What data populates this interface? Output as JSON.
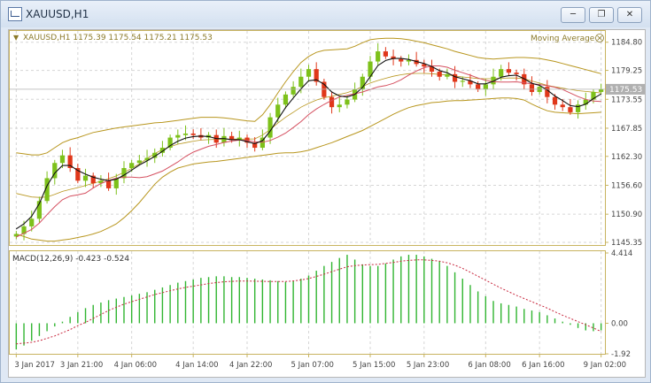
{
  "window": {
    "title": "XAUUSD,H1",
    "icon": "chart-window-icon",
    "buttons": [
      "minimize-icon",
      "restore-icon",
      "close-icon"
    ]
  },
  "header": {
    "symbol_info": "XAUUSD,H1  1175.39 1175.54 1175.21 1175.53",
    "indicator_label": "Moving Average"
  },
  "macd_label": "MACD(12,26,9) -0.423 -0.524",
  "price_badge": "1175.53",
  "colors": {
    "bull": "#7dc11a",
    "bear": "#e0371a",
    "band": "#b8961e",
    "ma_fast": "#111111",
    "ma_slow": "#d55060",
    "macd_hist": "#31b531",
    "macd_signal": "#c8283e",
    "grid": "#d6d6d6",
    "axis": "#c8b460"
  },
  "chart_data": [
    {
      "type": "candlestick",
      "title": "XAUUSD,H1",
      "y_ticks": [
        1184.8,
        1179.25,
        1173.55,
        1167.85,
        1162.3,
        1156.6,
        1150.9,
        1145.35
      ],
      "y_tick_labels": [
        "1184.80",
        "1179.25",
        "1173.55",
        "1167.85",
        "1162.30",
        "1156.60",
        "1150.90",
        "1145.35"
      ],
      "ylim": [
        1145.0,
        1186.5
      ],
      "x_tick_labels": [
        "3 Jan 2017",
        "3 Jan 21:00",
        "4 Jan 06:00",
        "4 Jan 14:00",
        "4 Jan 22:00",
        "5 Jan 07:00",
        "5 Jan 15:00",
        "5 Jan 23:00",
        "6 Jan 08:00",
        "6 Jan 16:00",
        "9 Jan 02:00"
      ],
      "close": [
        1147.0,
        1148.5,
        1150.0,
        1153.5,
        1158.0,
        1161.0,
        1162.5,
        1160.0,
        1157.5,
        1158.5,
        1157.0,
        1157.5,
        1156.0,
        1158.0,
        1160.0,
        1161.0,
        1161.5,
        1162.0,
        1163.0,
        1164.0,
        1166.0,
        1166.5,
        1166.8,
        1166.5,
        1166.0,
        1166.5,
        1165.0,
        1166.3,
        1165.5,
        1166.0,
        1165.0,
        1164.0,
        1166.0,
        1170.0,
        1172.5,
        1174.5,
        1176.0,
        1178.0,
        1179.5,
        1177.0,
        1174.0,
        1172.0,
        1172.5,
        1173.5,
        1175.5,
        1178.0,
        1181.0,
        1183.0,
        1182.0,
        1181.5,
        1181.0,
        1181.3,
        1180.5,
        1180.0,
        1179.0,
        1178.0,
        1178.5,
        1177.0,
        1177.2,
        1176.5,
        1175.5,
        1176.5,
        1178.0,
        1179.5,
        1178.8,
        1178.5,
        1176.5,
        1175.0,
        1176.0,
        1174.0,
        1172.5,
        1172.0,
        1171.0,
        1172.5,
        1173.5,
        1175.0,
        1175.53
      ],
      "ma_fast": [
        1148.0,
        1149.0,
        1150.5,
        1153.0,
        1156.5,
        1159.0,
        1160.5,
        1160.5,
        1159.5,
        1158.8,
        1158.2,
        1157.8,
        1157.5,
        1157.8,
        1158.6,
        1159.6,
        1160.6,
        1161.4,
        1162.3,
        1163.3,
        1164.4,
        1165.3,
        1165.9,
        1166.2,
        1166.3,
        1166.2,
        1165.8,
        1165.8,
        1165.6,
        1165.6,
        1165.2,
        1164.8,
        1165.4,
        1167.3,
        1169.6,
        1171.9,
        1173.8,
        1175.6,
        1177.2,
        1177.4,
        1176.5,
        1175.0,
        1174.2,
        1174.0,
        1174.5,
        1175.9,
        1178.0,
        1180.2,
        1181.2,
        1181.6,
        1181.6,
        1181.4,
        1181.0,
        1180.6,
        1180.0,
        1179.2,
        1178.8,
        1178.0,
        1177.6,
        1177.2,
        1176.6,
        1176.6,
        1177.1,
        1177.9,
        1178.2,
        1178.3,
        1177.6,
        1176.7,
        1176.3,
        1175.4,
        1174.2,
        1173.3,
        1172.3,
        1172.1,
        1172.6,
        1173.7,
        1174.6
      ],
      "bb_upper": [
        1163.0,
        1162.8,
        1162.6,
        1162.6,
        1163.0,
        1164.0,
        1165.0,
        1165.6,
        1166.0,
        1166.5,
        1167.0,
        1167.3,
        1167.6,
        1167.9,
        1168.1,
        1168.3,
        1168.5,
        1168.7,
        1168.9,
        1169.0,
        1169.2,
        1169.4,
        1169.6,
        1169.8,
        1170.0,
        1170.0,
        1170.0,
        1169.9,
        1169.7,
        1169.5,
        1169.3,
        1169.2,
        1170.5,
        1172.5,
        1174.8,
        1177.0,
        1179.0,
        1180.8,
        1182.0,
        1182.8,
        1183.2,
        1183.3,
        1183.4,
        1183.5,
        1184.0,
        1184.7,
        1185.3,
        1185.5,
        1185.6,
        1185.6,
        1185.5,
        1185.3,
        1185.0,
        1184.7,
        1184.3,
        1183.9,
        1183.5,
        1183.0,
        1182.6,
        1182.2,
        1181.8,
        1181.6,
        1181.5,
        1181.6,
        1181.7,
        1181.8,
        1181.8,
        1181.7,
        1181.6,
        1181.3,
        1181.0,
        1180.6,
        1180.2,
        1179.8,
        1179.4,
        1179.0,
        1178.6
      ],
      "bb_lower": [
        1147.0,
        1146.5,
        1146.0,
        1145.8,
        1145.6,
        1145.6,
        1145.8,
        1146.0,
        1146.3,
        1146.6,
        1147.0,
        1147.5,
        1148.2,
        1149.0,
        1150.2,
        1151.6,
        1153.2,
        1155.0,
        1156.8,
        1158.2,
        1159.2,
        1160.0,
        1160.4,
        1160.8,
        1161.0,
        1161.2,
        1161.3,
        1161.5,
        1161.7,
        1161.9,
        1162.1,
        1162.3,
        1162.5,
        1162.7,
        1162.9,
        1163.0,
        1163.0,
        1163.2,
        1163.5,
        1164.0,
        1164.5,
        1165.0,
        1165.6,
        1166.2,
        1166.8,
        1167.4,
        1168.2,
        1169.0,
        1169.8,
        1170.6,
        1171.3,
        1171.9,
        1172.3,
        1172.6,
        1172.9,
        1173.0,
        1173.2,
        1173.3,
        1173.3,
        1173.4,
        1173.5,
        1173.6,
        1173.7,
        1173.8,
        1173.8,
        1173.7,
        1173.4,
        1172.6,
        1171.9,
        1171.3,
        1171.0,
        1170.9,
        1170.8,
        1170.7,
        1170.8,
        1170.9,
        1171.0
      ],
      "legend": "Moving Average"
    },
    {
      "type": "bar",
      "title": "MACD(12,26,9) -0.423 -0.524",
      "y_ticks": [
        4.414,
        0.0,
        -1.92
      ],
      "y_tick_labels": [
        "4.414",
        "0.00",
        "-1.92"
      ],
      "ylim": [
        -1.92,
        4.414
      ],
      "histogram": [
        -1.65,
        -1.4,
        -1.1,
        -0.8,
        -0.5,
        -0.2,
        0.1,
        0.4,
        0.7,
        0.95,
        1.15,
        1.3,
        1.45,
        1.55,
        1.65,
        1.75,
        1.85,
        1.95,
        2.1,
        2.25,
        2.4,
        2.55,
        2.65,
        2.75,
        2.85,
        2.9,
        2.95,
        2.95,
        2.9,
        2.9,
        2.85,
        2.8,
        2.75,
        2.7,
        2.65,
        2.6,
        2.65,
        2.8,
        3.0,
        3.3,
        3.6,
        3.85,
        4.1,
        4.3,
        4.0,
        3.7,
        3.6,
        3.6,
        3.75,
        4.0,
        4.2,
        4.3,
        4.3,
        4.2,
        4.05,
        3.9,
        3.6,
        3.2,
        2.8,
        2.4,
        2.0,
        1.7,
        1.4,
        1.25,
        1.15,
        1.05,
        0.9,
        0.8,
        0.7,
        0.5,
        0.3,
        0.1,
        -0.1,
        -0.3,
        -0.45,
        -0.5,
        -0.45
      ],
      "signal": [
        -1.3,
        -1.25,
        -1.2,
        -1.1,
        -0.95,
        -0.8,
        -0.6,
        -0.4,
        -0.15,
        0.05,
        0.3,
        0.55,
        0.8,
        1.0,
        1.2,
        1.35,
        1.5,
        1.65,
        1.8,
        1.92,
        2.04,
        2.15,
        2.25,
        2.33,
        2.41,
        2.49,
        2.55,
        2.6,
        2.63,
        2.65,
        2.65,
        2.64,
        2.63,
        2.62,
        2.62,
        2.62,
        2.66,
        2.72,
        2.81,
        2.94,
        3.08,
        3.24,
        3.4,
        3.55,
        3.62,
        3.66,
        3.68,
        3.7,
        3.76,
        3.82,
        3.9,
        3.95,
        3.98,
        3.98,
        3.95,
        3.9,
        3.8,
        3.65,
        3.45,
        3.2,
        2.95,
        2.7,
        2.45,
        2.2,
        1.98,
        1.75,
        1.55,
        1.35,
        1.15,
        0.95,
        0.72,
        0.5,
        0.3,
        0.1,
        -0.1,
        -0.3,
        -0.52
      ]
    }
  ]
}
